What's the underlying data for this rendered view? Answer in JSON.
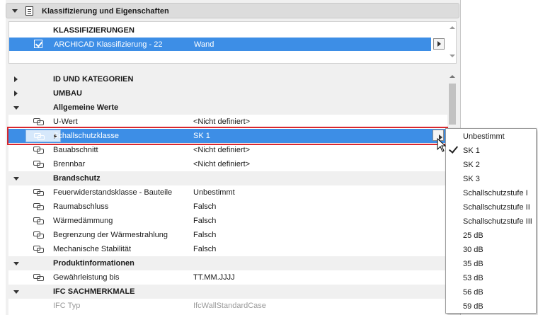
{
  "section": {
    "title": "Klassifizierung und Eigenschaften",
    "icon": "document-icon"
  },
  "classifications": {
    "heading": "KLASSIFIZIERUNGEN",
    "row": {
      "checked": true,
      "system": "ARCHICAD Klassifizierung - 22",
      "value": "Wand"
    }
  },
  "rows": [
    {
      "type": "group",
      "expanded": false,
      "name": "ID UND KATEGORIEN"
    },
    {
      "type": "group",
      "expanded": false,
      "name": "UMBAU"
    },
    {
      "type": "group",
      "expanded": true,
      "name": "Allgemeine Werte"
    },
    {
      "type": "prop",
      "name": "U-Wert",
      "value": "<Nicht definiert>"
    },
    {
      "type": "prop",
      "name": "Schallschutzklasse",
      "value": "SK 1",
      "selected": true
    },
    {
      "type": "prop",
      "name": "Bauabschnitt",
      "value": "<Nicht definiert>"
    },
    {
      "type": "prop",
      "name": "Brennbar",
      "value": "<Nicht definiert>"
    },
    {
      "type": "group",
      "expanded": true,
      "name": "Brandschutz"
    },
    {
      "type": "prop",
      "name": "Feuerwiderstandsklasse - Bauteile",
      "value": "Unbestimmt"
    },
    {
      "type": "prop",
      "name": "Raumabschluss",
      "value": "Falsch"
    },
    {
      "type": "prop",
      "name": "Wärmedämmung",
      "value": "Falsch"
    },
    {
      "type": "prop",
      "name": "Begrenzung der Wärmestrahlung",
      "value": "Falsch"
    },
    {
      "type": "prop",
      "name": "Mechanische Stabilität",
      "value": "Falsch"
    },
    {
      "type": "group",
      "expanded": true,
      "name": "Produktinformationen"
    },
    {
      "type": "prop",
      "name": "Gewährleistung bis",
      "value": "TT.MM.JJJJ"
    },
    {
      "type": "group",
      "expanded": true,
      "name": "IFC SACHMERKMALE"
    },
    {
      "type": "prop-dim",
      "name": "IFC Typ",
      "value": "IfcWallStandardCase"
    }
  ],
  "dropdown": {
    "selected": "SK 1",
    "options": [
      "Unbestimmt",
      "SK 1",
      "SK 2",
      "SK 3",
      "Schallschutzstufe I",
      "Schallschutzstufe II",
      "Schallschutzstufe III",
      "25 dB",
      "30 dB",
      "35 dB",
      "53 dB",
      "56 dB",
      "59 dB"
    ]
  },
  "colors": {
    "selection": "#3d8ee6",
    "highlight_border": "#d8282f"
  }
}
